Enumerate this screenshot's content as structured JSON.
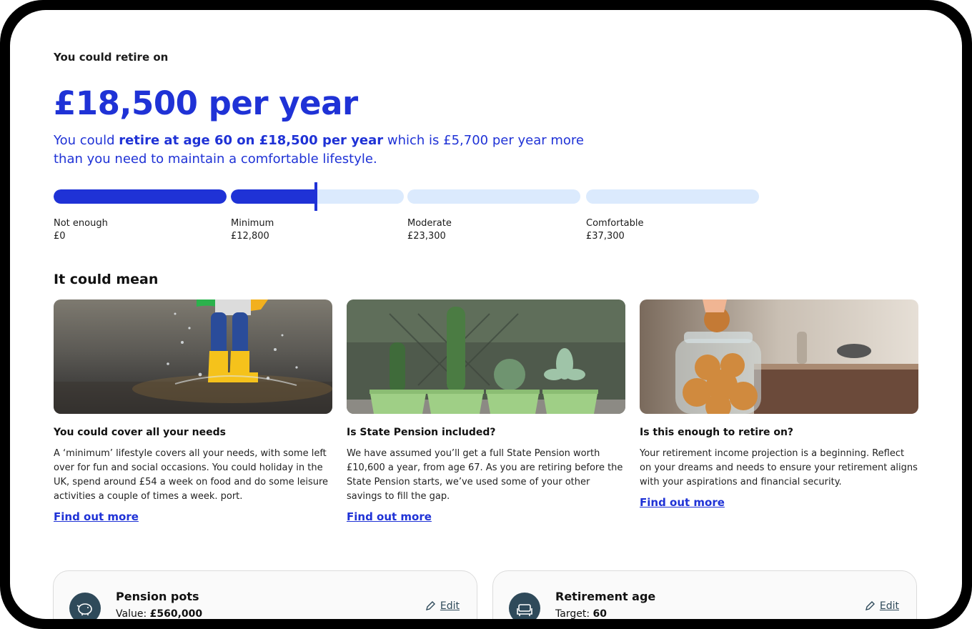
{
  "header": {
    "intro": "You could retire on",
    "amount": "£18,500 per year",
    "summary": {
      "part1": "You could ",
      "bold": "retire at age 60 on £18,500 per year",
      "part2": " which is £5,700 per year more than you need to maintain a comfortable lifestyle."
    }
  },
  "scale": {
    "progress_fraction": 0.365,
    "levels": [
      {
        "label": "Not enough",
        "value": "£0"
      },
      {
        "label": "Minimum",
        "value": "£12,800"
      },
      {
        "label": "Moderate",
        "value": "£23,300"
      },
      {
        "label": "Comfortable",
        "value": "£37,300"
      }
    ]
  },
  "section_title": "It could mean",
  "cards": [
    {
      "image": "child-in-yellow-boots-splashing-puddle",
      "title": "You could cover all your needs",
      "text": "A ‘minimum’ lifestyle covers all your needs, with some left over for fun and social occasions. You could holiday in the UK, spend around £54 a week on food and do some leisure activities a couple of times a week. port.",
      "link": "Find out more"
    },
    {
      "image": "cacti-in-green-pots",
      "title": "Is State Pension included?",
      "text": "We have assumed you’ll get a full State Pension worth £10,600 a year, from age 67. As you are retiring before the State Pension starts, we’ve used some of your other savings to fill the gap.",
      "link": "Find out more"
    },
    {
      "image": "hand-taking-cookie-from-jar",
      "title": "Is this enough to retire on?",
      "text": "Your retirement income projection is a beginning. Reflect on your dreams and needs to ensure your retirement aligns with your aspirations and financial security.",
      "link": "Find out more"
    }
  ],
  "info_cards": [
    {
      "icon": "piggy-bank-icon",
      "title": "Pension pots",
      "label": "Value: ",
      "value": "£560,000",
      "edit": "Edit"
    },
    {
      "icon": "armchair-icon",
      "title": "Retirement age",
      "label": "Target: ",
      "value": "60",
      "edit": "Edit"
    }
  ],
  "colors": {
    "accent": "#1f32d6",
    "track": "#dbeafd",
    "icon_bg": "#2f4a5a"
  }
}
